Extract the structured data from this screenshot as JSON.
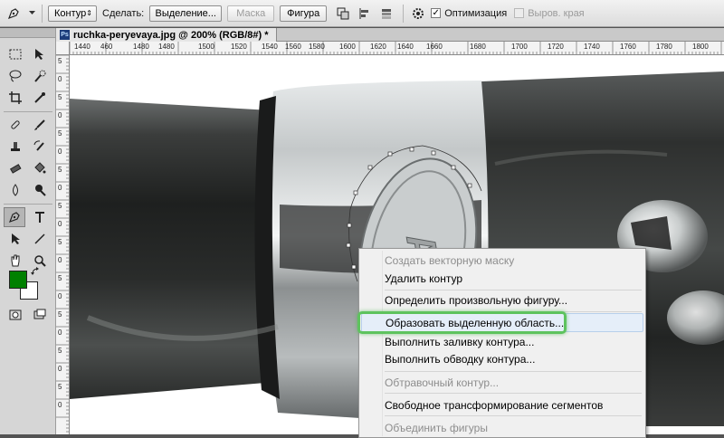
{
  "options_bar": {
    "tool_icon": "pen-icon",
    "mode_select": "Контур",
    "make_label": "Сделать:",
    "selection_button": "Выделение...",
    "mask_button": "Маска",
    "shape_button": "Фигура",
    "path_ops_icon": "path-operations-icon",
    "path_align_icon": "path-alignment-icon",
    "path_arrange_icon": "path-arrangement-icon",
    "gear_icon": "gear-icon",
    "auto_add_delete_label": "Оптимизация",
    "auto_add_delete_checked": true,
    "align_edges_label": "Выров. края",
    "align_edges_checked": false
  },
  "document": {
    "tab_title": "ruchka-peryevaya.jpg @ 200% (RGB/8#) *",
    "badge": "Ps"
  },
  "ruler_h": [
    "1440",
    "460",
    "1480",
    "1480",
    "1500",
    "1520",
    "1540",
    "1560",
    "1580",
    "1600",
    "1620",
    "1640",
    "1660",
    "1680",
    "1700",
    "1720",
    "1740",
    "1760",
    "1780",
    "1800"
  ],
  "ruler_v": [
    "5",
    "0",
    "5",
    "0",
    "5",
    "0",
    "5",
    "0",
    "5",
    "0",
    "5",
    "0",
    "5",
    "0",
    "5",
    "0",
    "5",
    "0",
    "5",
    "0"
  ],
  "toolbox": {
    "foreground_color": "#008000",
    "background_color": "#ffffff"
  },
  "context_menu": {
    "items": [
      {
        "label": "Создать векторную маску",
        "disabled": true
      },
      {
        "label": "Удалить контур",
        "disabled": false
      },
      {
        "label": "Определить произвольную фигуру...",
        "disabled": false
      },
      {
        "label": "Образовать выделенную область...",
        "disabled": false,
        "highlighted": true
      },
      {
        "label": "Выполнить заливку контура...",
        "disabled": false
      },
      {
        "label": "Выполнить обводку контура...",
        "disabled": false
      },
      {
        "label": "Обтравочный контур...",
        "disabled": true
      },
      {
        "label": "Свободное трансформирование сегментов",
        "disabled": false
      },
      {
        "label": "Объединить фигуры",
        "disabled": true
      }
    ]
  },
  "colors": {
    "highlight_ring": "#5ec35e",
    "workspace": "#535353"
  }
}
